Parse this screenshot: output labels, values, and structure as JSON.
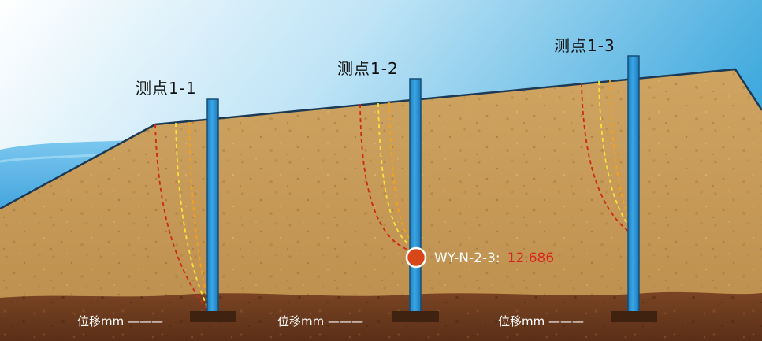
{
  "colors": {
    "sky_top": "#2f9fd8",
    "sky_bottom": "#ffffff",
    "water": "#46ace6",
    "soil": "#c79a55",
    "ground": "#6b3a1d",
    "pipe": "#2e95d6",
    "base_plate": "#3f2210",
    "curve_red": "#cc2a14",
    "curve_yellow": "#f6e23a",
    "curve_orange": "#f0a21c",
    "marker": "#d8471a",
    "reading_value": "#d9261c"
  },
  "points": [
    {
      "label": "测点1-1",
      "displacement_label": "位移mm ———"
    },
    {
      "label": "测点1-2",
      "displacement_label": "位移mm ———"
    },
    {
      "label": "测点1-3",
      "displacement_label": "位移mm ———"
    }
  ],
  "reading": {
    "id": "WY-N-2-3:",
    "value": "12.686"
  }
}
